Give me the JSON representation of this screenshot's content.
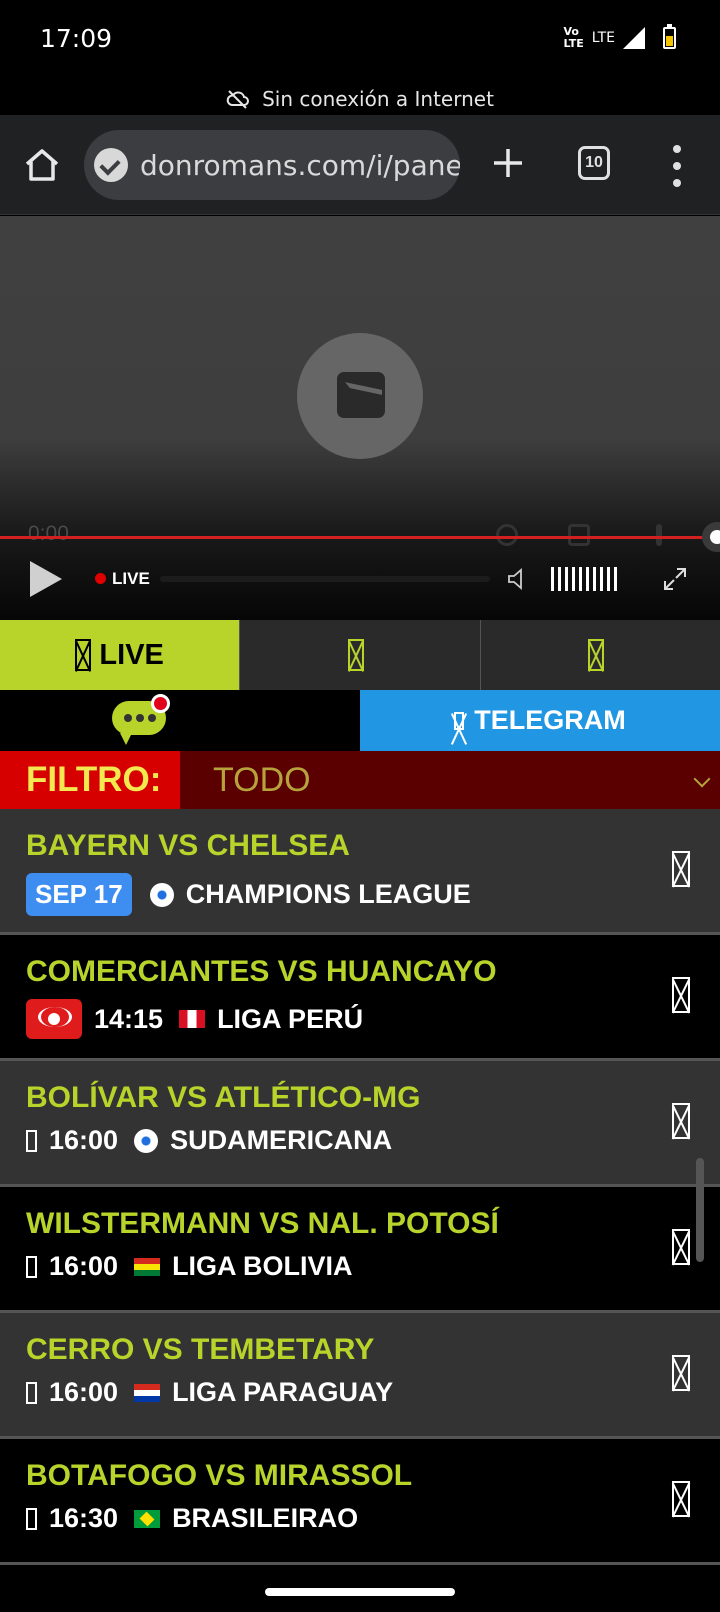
{
  "status_bar": {
    "time": "17:09",
    "volte": "Vo\nLTE",
    "lte": "LTE",
    "icons": [
      "volte-icon",
      "signal-icon",
      "battery-charging-icon"
    ]
  },
  "browser": {
    "offline_text": "Sin conexión a Internet",
    "url": "donromans.com/i/panel/",
    "tab_count": "10",
    "icons": [
      "home-icon",
      "secure-check-icon",
      "plus-icon",
      "tabs-icon",
      "more-vert-icon"
    ]
  },
  "player": {
    "current_time": "0:00",
    "live_label": "LIVE",
    "progress_fraction": 1.0,
    "accent_color": "#d21f1f"
  },
  "tabs": [
    {
      "label": "LIVE",
      "icon": "live-glyph",
      "active": true
    },
    {
      "label": "",
      "icon": "tab-glyph",
      "active": false
    },
    {
      "label": "",
      "icon": "tab-glyph",
      "active": false
    }
  ],
  "chat_row": {
    "chat_icon": "chat-bubble-icon",
    "telegram_label": "TELEGRAM",
    "telegram_color": "#2197e3"
  },
  "filter": {
    "label": "FILTRO:",
    "selected": "TODO"
  },
  "matches": [
    {
      "title": "BAYERN VS CHELSEA",
      "date": "SEP 17",
      "time": "",
      "league": "CHAMPIONS LEAGUE",
      "league_icon": "soccer-ball-icon",
      "status": "scheduled"
    },
    {
      "title": "COMERCIANTES VS HUANCAYO",
      "date": "",
      "time": "14:15",
      "league": "LIGA PERÚ",
      "league_icon": "peru-flag-icon",
      "status": "live"
    },
    {
      "title": "BOLÍVAR VS ATLÉTICO-MG",
      "date": "",
      "time": "16:00",
      "league": "SUDAMERICANA",
      "league_icon": "soccer-ball-icon",
      "status": "today"
    },
    {
      "title": "WILSTERMANN VS NAL. POTOSÍ",
      "date": "",
      "time": "16:00",
      "league": "LIGA BOLIVIA",
      "league_icon": "bolivia-flag-icon",
      "status": "today"
    },
    {
      "title": "CERRO VS TEMBETARY",
      "date": "",
      "time": "16:00",
      "league": "LIGA PARAGUAY",
      "league_icon": "paraguay-flag-icon",
      "status": "today"
    },
    {
      "title": "BOTAFOGO VS MIRASSOL",
      "date": "",
      "time": "16:30",
      "league": "BRASILEIRAO",
      "league_icon": "brazil-flag-icon",
      "status": "today"
    }
  ],
  "colors": {
    "accent_green": "#b8d42a",
    "filter_red": "#d60000",
    "filter_dark": "#5a0000",
    "date_badge_blue": "#3e8ef2"
  }
}
